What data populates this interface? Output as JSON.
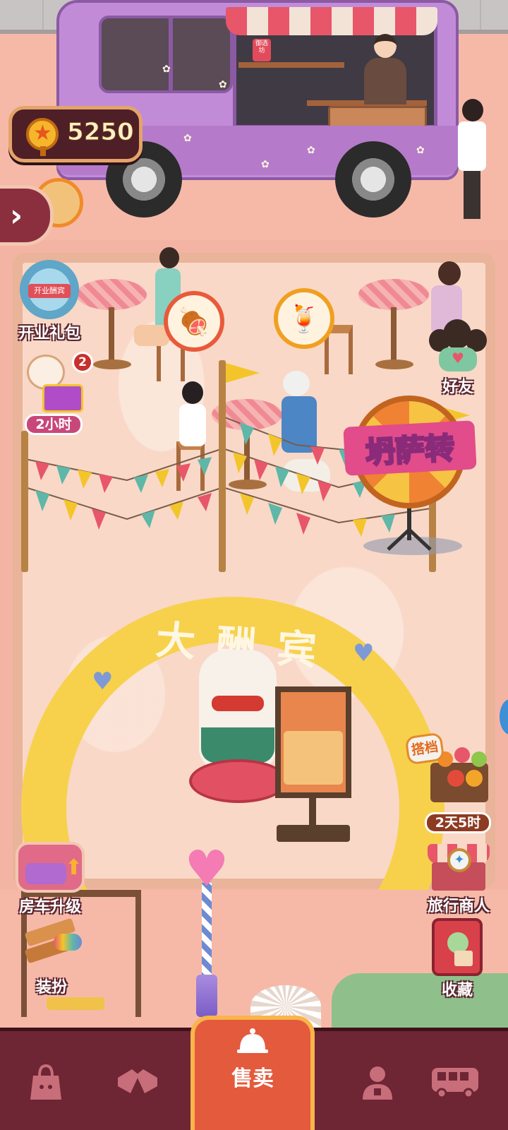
{
  "hud": {
    "coins": "5250"
  },
  "left_buttons": {
    "opening_gift": "开业礼包",
    "opening_gift_ribbon": "开业酬宾",
    "gift_badge": "2",
    "gift_timer": "2小时",
    "truck_upgrade": "房车升级",
    "dress_up": "装扮"
  },
  "right_buttons": {
    "friends": "好友",
    "partner_tag": "搭档",
    "partner_timer": "2天5时",
    "travel_merchant": "旅行商人",
    "collection": "收藏"
  },
  "scene": {
    "spin_wheel_label": "坍萨转",
    "arch_text": "大酬宾",
    "truck_sign": "御选坊"
  },
  "bottom_nav": {
    "center_label": "售卖",
    "items": [
      {
        "icon": "shop-bag-icon"
      },
      {
        "icon": "handshake-icon"
      },
      {
        "icon": "sell-bell-icon"
      },
      {
        "icon": "staff-icon"
      },
      {
        "icon": "bus-icon"
      }
    ]
  },
  "colors": {
    "nav_background": "#6e2534",
    "nav_active": "#e45a3c",
    "coin_box": "#4e1f26",
    "truck": "#c28bd8",
    "arch": "#f7d14c"
  }
}
